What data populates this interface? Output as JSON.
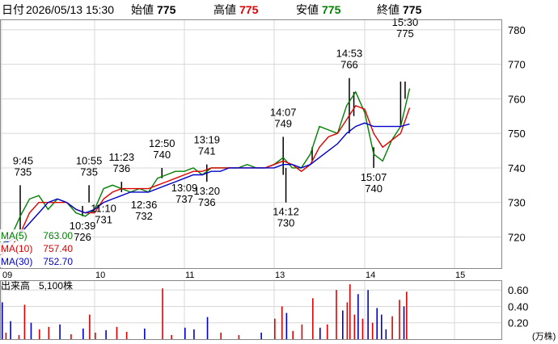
{
  "header": {
    "date_label": "日付",
    "datetime": "2026/05/13 15:30",
    "open_label": "始値",
    "open": "775",
    "high_label": "高値",
    "high": "775",
    "low_label": "安値",
    "low": "775",
    "close_label": "終値",
    "close": "775",
    "high_color": "#e00000",
    "low_color": "#008000"
  },
  "chart_data": [
    {
      "type": "line",
      "title": "",
      "x_ticks": [
        "09",
        "10",
        "11",
        "13",
        "14",
        "15"
      ],
      "y_ticks": [
        720,
        730,
        740,
        750,
        760,
        770,
        780
      ],
      "ylim": [
        711,
        783
      ],
      "grid": true,
      "legend": "bottom-left",
      "legend_entries": [
        {
          "name": "MA(5)",
          "value": "763.00",
          "color": "#008000"
        },
        {
          "name": "MA(10)",
          "value": "757.40",
          "color": "#e00000"
        },
        {
          "name": "MA(30)",
          "value": "752.70",
          "color": "#0000cc"
        }
      ],
      "annotations": [
        {
          "time": "9:45",
          "value": "735",
          "x": 0.23,
          "y": 735,
          "pos": "above"
        },
        {
          "time": "10:39",
          "value": "726",
          "x": 0.87,
          "y": 726,
          "pos": "below"
        },
        {
          "time": "10:55",
          "value": "735",
          "x": 0.94,
          "y": 735,
          "pos": "above"
        },
        {
          "time": "11:10",
          "value": "731",
          "x": 1.1,
          "y": 731,
          "pos": "below"
        },
        {
          "time": "11:23",
          "value": "736",
          "x": 1.3,
          "y": 736,
          "pos": "above"
        },
        {
          "time": "12:36",
          "value": "732",
          "x": 1.55,
          "y": 732,
          "pos": "below"
        },
        {
          "time": "12:50",
          "value": "740",
          "x": 1.75,
          "y": 740,
          "pos": "above"
        },
        {
          "time": "13:09",
          "value": "737",
          "x": 2.0,
          "y": 737,
          "pos": "below"
        },
        {
          "time": "13:19",
          "value": "741",
          "x": 2.25,
          "y": 741,
          "pos": "above"
        },
        {
          "time": "13:20",
          "value": "736",
          "x": 2.25,
          "y": 736,
          "pos": "below"
        },
        {
          "time": "14:07",
          "value": "749",
          "x": 3.1,
          "y": 749,
          "pos": "above"
        },
        {
          "time": "14:12",
          "value": "730",
          "x": 3.13,
          "y": 730,
          "pos": "below"
        },
        {
          "time": "14:53",
          "value": "766",
          "x": 3.83,
          "y": 766,
          "pos": "above"
        },
        {
          "time": "15:07",
          "value": "740",
          "x": 4.1,
          "y": 740,
          "pos": "below"
        },
        {
          "time": "15:30",
          "value": "775",
          "x": 4.45,
          "y": 775,
          "pos": "above"
        }
      ],
      "series": [
        {
          "name": "MA(5)",
          "color": "#008000",
          "x": [
            0.0,
            0.1,
            0.2,
            0.3,
            0.4,
            0.5,
            0.6,
            0.7,
            0.8,
            0.9,
            1.0,
            1.1,
            1.2,
            1.3,
            1.4,
            1.5,
            1.6,
            1.7,
            1.8,
            1.9,
            2.0,
            2.1,
            2.2,
            2.3,
            2.4,
            2.5,
            2.6,
            2.7,
            2.8,
            2.9,
            3.0,
            3.1,
            3.2,
            3.3,
            3.4,
            3.5,
            3.6,
            3.7,
            3.8,
            3.9,
            4.0,
            4.1,
            4.2,
            4.3,
            4.4,
            4.5
          ],
          "y": [
            718,
            720,
            726,
            731,
            732,
            728,
            731,
            730,
            727,
            726,
            728,
            734,
            735,
            734,
            733,
            734,
            733,
            737,
            738,
            739,
            739,
            740,
            738,
            740,
            740,
            740,
            740,
            741,
            740,
            740,
            741,
            743,
            740,
            740,
            744,
            752,
            751,
            750,
            758,
            762,
            756,
            744,
            742,
            748,
            752,
            763
          ]
        },
        {
          "name": "MA(10)",
          "color": "#e00000",
          "x": [
            0.0,
            0.1,
            0.2,
            0.3,
            0.4,
            0.5,
            0.6,
            0.7,
            0.8,
            0.9,
            1.0,
            1.1,
            1.2,
            1.3,
            1.4,
            1.5,
            1.6,
            1.7,
            1.8,
            1.9,
            2.0,
            2.1,
            2.2,
            2.3,
            2.4,
            2.5,
            2.6,
            2.7,
            2.8,
            2.9,
            3.0,
            3.1,
            3.2,
            3.3,
            3.4,
            3.5,
            3.6,
            3.7,
            3.8,
            3.9,
            4.0,
            4.1,
            4.2,
            4.3,
            4.4,
            4.5
          ],
          "y": [
            715,
            717,
            721,
            727,
            730,
            730,
            730,
            730,
            728,
            727,
            727,
            731,
            733,
            734,
            734,
            734,
            734,
            735,
            736,
            737,
            738,
            739,
            739,
            740,
            740,
            740,
            740,
            740,
            740,
            740,
            741,
            742,
            741,
            739,
            741,
            746,
            749,
            750,
            754,
            758,
            757,
            750,
            746,
            748,
            750,
            757.4
          ]
        },
        {
          "name": "MA(30)",
          "color": "#0000cc",
          "x": [
            0.0,
            0.1,
            0.2,
            0.3,
            0.4,
            0.5,
            0.6,
            0.7,
            0.8,
            0.9,
            1.0,
            1.1,
            1.2,
            1.3,
            1.4,
            1.5,
            1.6,
            1.7,
            1.8,
            1.9,
            2.0,
            2.1,
            2.2,
            2.3,
            2.4,
            2.5,
            2.6,
            2.7,
            2.8,
            2.9,
            3.0,
            3.1,
            3.2,
            3.3,
            3.4,
            3.5,
            3.6,
            3.7,
            3.8,
            3.9,
            4.0,
            4.1,
            4.2,
            4.3,
            4.4,
            4.5
          ],
          "y": [
            718,
            719,
            721,
            724,
            727,
            730,
            731,
            730,
            728,
            727,
            728,
            730,
            731,
            732,
            733,
            733,
            733,
            734,
            735,
            736,
            737,
            738,
            738,
            739,
            739,
            740,
            740,
            740,
            740,
            740,
            740,
            741,
            741,
            740,
            741,
            743,
            745,
            747,
            750,
            752,
            753,
            752,
            752,
            752,
            752,
            752.7
          ]
        }
      ],
      "candles": [
        {
          "x": 0.2,
          "low": 720,
          "high": 735
        },
        {
          "x": 0.87,
          "low": 726,
          "high": 729
        },
        {
          "x": 0.94,
          "low": 730,
          "high": 735
        },
        {
          "x": 1.3,
          "low": 733,
          "high": 736
        },
        {
          "x": 1.75,
          "low": 737,
          "high": 740
        },
        {
          "x": 2.25,
          "low": 736,
          "high": 741
        },
        {
          "x": 3.1,
          "low": 738,
          "high": 749
        },
        {
          "x": 3.13,
          "low": 730,
          "high": 740
        },
        {
          "x": 3.42,
          "low": 742,
          "high": 746
        },
        {
          "x": 3.83,
          "low": 750,
          "high": 766
        },
        {
          "x": 3.88,
          "low": 755,
          "high": 762
        },
        {
          "x": 4.1,
          "low": 740,
          "high": 746
        },
        {
          "x": 4.4,
          "low": 752,
          "high": 765
        },
        {
          "x": 4.45,
          "low": 760,
          "high": 765
        }
      ]
    },
    {
      "type": "bar",
      "title": "出来高",
      "value_label": "5,100株",
      "unit": "(万株)",
      "y_ticks": [
        "0.60",
        "0.40",
        "0.20"
      ],
      "ylim": [
        0,
        0.72
      ],
      "bars": [
        {
          "x": 0.0,
          "v": 0.45,
          "c": "#0000cc"
        },
        {
          "x": 0.04,
          "v": 0.08,
          "c": "#e00000"
        },
        {
          "x": 0.09,
          "v": 0.22,
          "c": "#0000cc"
        },
        {
          "x": 0.18,
          "v": 0.05,
          "c": "#e00000"
        },
        {
          "x": 0.24,
          "v": 0.42,
          "c": "#e00000"
        },
        {
          "x": 0.31,
          "v": 0.2,
          "c": "#0000cc"
        },
        {
          "x": 0.4,
          "v": 0.12,
          "c": "#e00000"
        },
        {
          "x": 0.5,
          "v": 0.15,
          "c": "#e00000"
        },
        {
          "x": 0.62,
          "v": 0.18,
          "c": "#0000cc"
        },
        {
          "x": 0.74,
          "v": 0.06,
          "c": "#e00000"
        },
        {
          "x": 0.87,
          "v": 0.13,
          "c": "#0000cc"
        },
        {
          "x": 0.94,
          "v": 0.3,
          "c": "#e00000"
        },
        {
          "x": 1.0,
          "v": 0.08,
          "c": "#e00000"
        },
        {
          "x": 1.12,
          "v": 0.11,
          "c": "#0000cc"
        },
        {
          "x": 1.24,
          "v": 0.15,
          "c": "#e00000"
        },
        {
          "x": 1.35,
          "v": 0.09,
          "c": "#e00000"
        },
        {
          "x": 1.55,
          "v": 0.13,
          "c": "#0000cc"
        },
        {
          "x": 1.75,
          "v": 0.62,
          "c": "#e00000"
        },
        {
          "x": 1.85,
          "v": 0.05,
          "c": "#e00000"
        },
        {
          "x": 2.0,
          "v": 0.14,
          "c": "#0000cc"
        },
        {
          "x": 2.1,
          "v": 0.12,
          "c": "#0000cc"
        },
        {
          "x": 2.25,
          "v": 0.27,
          "c": "#0000cc"
        },
        {
          "x": 2.4,
          "v": 0.08,
          "c": "#e00000"
        },
        {
          "x": 2.6,
          "v": 0.05,
          "c": "#e00000"
        },
        {
          "x": 2.85,
          "v": 0.08,
          "c": "#0000cc"
        },
        {
          "x": 3.0,
          "v": 0.25,
          "c": "#e00000"
        },
        {
          "x": 3.08,
          "v": 0.4,
          "c": "#e00000"
        },
        {
          "x": 3.13,
          "v": 0.32,
          "c": "#0000cc"
        },
        {
          "x": 3.2,
          "v": 0.1,
          "c": "#e00000"
        },
        {
          "x": 3.3,
          "v": 0.18,
          "c": "#e00000"
        },
        {
          "x": 3.42,
          "v": 0.5,
          "c": "#e00000"
        },
        {
          "x": 3.5,
          "v": 0.14,
          "c": "#0000cc"
        },
        {
          "x": 3.58,
          "v": 0.18,
          "c": "#e00000"
        },
        {
          "x": 3.68,
          "v": 0.6,
          "c": "#e00000"
        },
        {
          "x": 3.75,
          "v": 0.35,
          "c": "#0000cc"
        },
        {
          "x": 3.8,
          "v": 0.45,
          "c": "#e00000"
        },
        {
          "x": 3.83,
          "v": 0.67,
          "c": "#e00000"
        },
        {
          "x": 3.88,
          "v": 0.3,
          "c": "#e00000"
        },
        {
          "x": 3.92,
          "v": 0.55,
          "c": "#0000cc"
        },
        {
          "x": 3.97,
          "v": 0.25,
          "c": "#e00000"
        },
        {
          "x": 4.03,
          "v": 0.6,
          "c": "#0000cc"
        },
        {
          "x": 4.08,
          "v": 0.2,
          "c": "#e00000"
        },
        {
          "x": 4.13,
          "v": 0.38,
          "c": "#0000cc"
        },
        {
          "x": 4.18,
          "v": 0.3,
          "c": "#0000cc"
        },
        {
          "x": 4.23,
          "v": 0.12,
          "c": "#0000cc"
        },
        {
          "x": 4.3,
          "v": 0.28,
          "c": "#e00000"
        },
        {
          "x": 4.38,
          "v": 0.48,
          "c": "#e00000"
        },
        {
          "x": 4.43,
          "v": 0.4,
          "c": "#0000cc"
        },
        {
          "x": 4.46,
          "v": 0.58,
          "c": "#e00000"
        }
      ]
    }
  ]
}
